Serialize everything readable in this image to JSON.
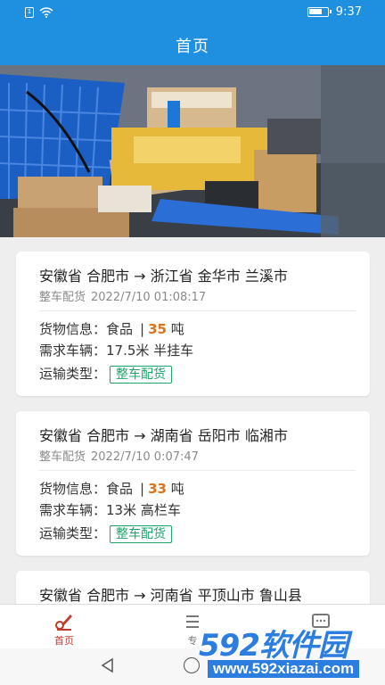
{
  "status_bar": {
    "time": "9:37"
  },
  "header": {
    "title": "首页"
  },
  "colors": {
    "primary": "#1f8fe0",
    "accent_orange": "#e0721a",
    "tag_green": "#1ea56a",
    "nav_active": "#c0392b"
  },
  "cards": [
    {
      "route": "安徽省 合肥市 → 浙江省 金华市 兰溪市",
      "type_label": "整车配货",
      "time": "2022/7/10 01:08:17",
      "goods_label": "货物信息：",
      "goods_name": "食品",
      "separator": "|",
      "weight": "35",
      "weight_unit": "吨",
      "vehicle_label": "需求车辆：",
      "vehicle": "17.5米 半挂车",
      "transport_label": "运输类型：",
      "transport_tag": "整车配货"
    },
    {
      "route": "安徽省 合肥市 → 湖南省 岳阳市 临湘市",
      "type_label": "整车配货",
      "time": "2022/7/10 0:07:47",
      "goods_label": "货物信息：",
      "goods_name": "食品",
      "separator": "|",
      "weight": "33",
      "weight_unit": "吨",
      "vehicle_label": "需求车辆：",
      "vehicle": "13米 高栏车",
      "transport_label": "运输类型：",
      "transport_tag": "整车配货"
    },
    {
      "route": "安徽省 合肥市 → 河南省 平顶山市 鲁山县"
    }
  ],
  "bottom_nav": [
    {
      "label": "首页",
      "icon": "pen-icon",
      "active": true
    },
    {
      "label": "专",
      "icon": "list-icon",
      "active": false
    },
    {
      "label": "",
      "icon": "message-icon",
      "active": false
    }
  ],
  "watermark": {
    "big": "592软件园",
    "small": "www.592xiazai.com"
  }
}
